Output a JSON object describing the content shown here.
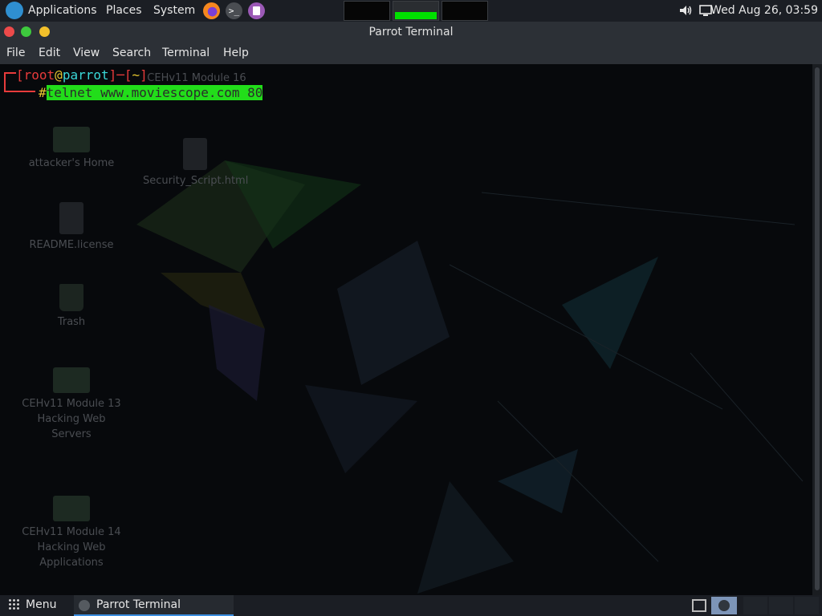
{
  "top_panel": {
    "applications": "Applications",
    "places": "Places",
    "system": "System",
    "clock": "Wed Aug 26, 03:59",
    "launchers": [
      "firefox-icon",
      "terminal-icon",
      "text-editor-icon"
    ],
    "terminal_glyph": ">_"
  },
  "window": {
    "title": "Parrot Terminal",
    "menu": [
      "File",
      "Edit",
      "View",
      "Search",
      "Terminal",
      "Help"
    ]
  },
  "terminal": {
    "user": "root",
    "at": "@",
    "host": "parrot",
    "cwd": "~",
    "prompt_char": "#",
    "command": "telnet www.moviescope.com 80"
  },
  "desktop_icons": [
    {
      "label": "attacker's Home"
    },
    {
      "label": "README.license"
    },
    {
      "label": "Trash"
    },
    {
      "label": "CEHv11 Module 13 Hacking Web Servers"
    },
    {
      "label": "CEHv11 Module 14 Hacking Web Applications"
    },
    {
      "label": "CEHv11 Module 16 Networks"
    },
    {
      "label": "Security_Script.html"
    }
  ],
  "bottom_panel": {
    "menu": "Menu",
    "task": "Parrot Terminal"
  },
  "colors": {
    "panel_bg": "#1b1e24",
    "command_highlight": "#22dd1a",
    "prompt_red": "#e83b3b",
    "prompt_cyan": "#3ad8d8",
    "close": "#ed4a4a",
    "minimize": "#3ec93e",
    "maximize": "#f2c02b"
  }
}
